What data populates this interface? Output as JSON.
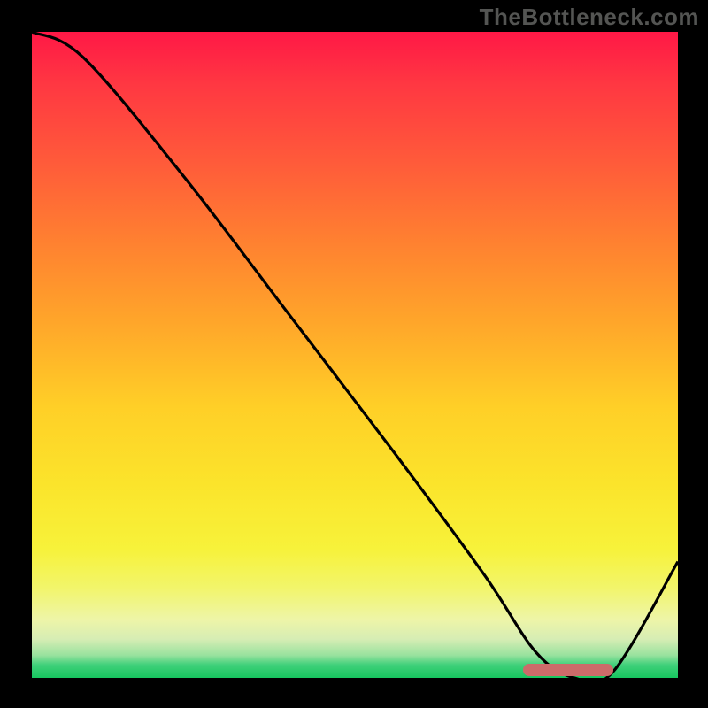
{
  "watermark": "TheBottleneck.com",
  "chart_data": {
    "type": "line",
    "title": "",
    "xlabel": "",
    "ylabel": "",
    "xlim": [
      0,
      100
    ],
    "ylim": [
      0,
      100
    ],
    "series": [
      {
        "name": "curve",
        "x": [
          0,
          8,
          24,
          40,
          56,
          70,
          78,
          84,
          90,
          100
        ],
        "y": [
          100,
          96,
          77,
          56,
          35,
          16,
          4,
          0,
          1,
          18
        ]
      }
    ],
    "marker": {
      "x_start": 76,
      "x_end": 90,
      "y": 0.5,
      "color": "#cc6b6a"
    },
    "gradient_stops": [
      {
        "pos": 0,
        "color": "#ff1846"
      },
      {
        "pos": 50,
        "color": "#ffcf27"
      },
      {
        "pos": 80,
        "color": "#f7f23a"
      },
      {
        "pos": 100,
        "color": "#17c65f"
      }
    ]
  }
}
